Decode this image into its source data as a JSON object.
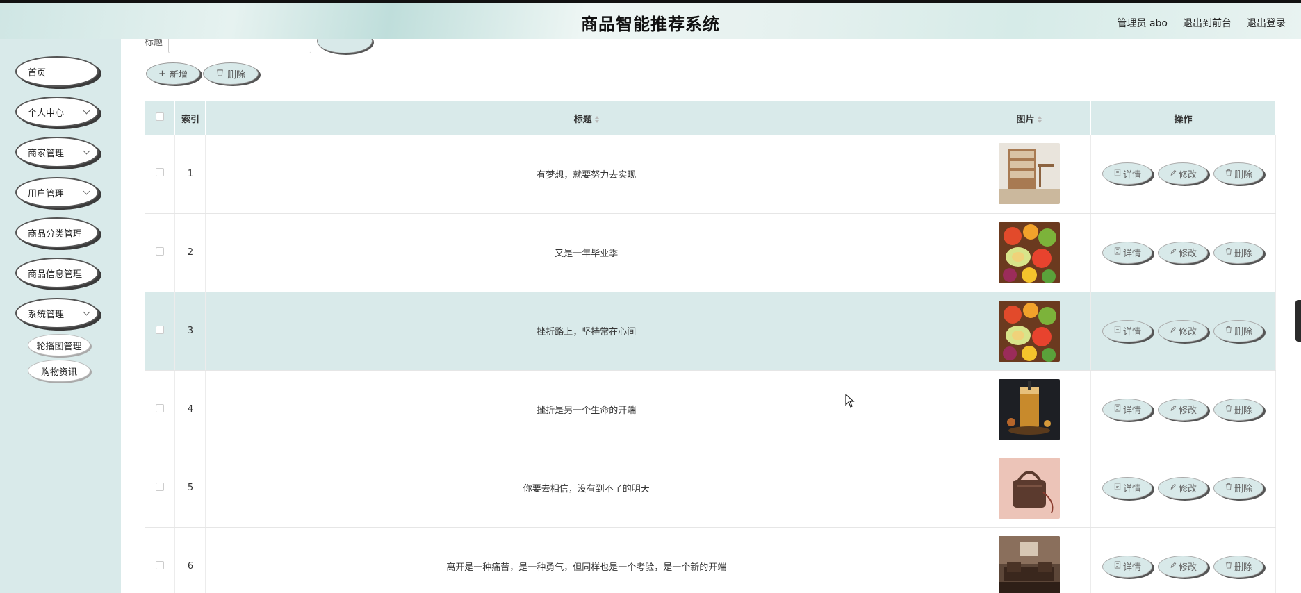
{
  "header": {
    "title": "商品智能推荐系统",
    "admin": "管理员 abo",
    "to_front": "退出到前台",
    "logout": "退出登录"
  },
  "sidebar": {
    "items": [
      {
        "label": "首页"
      },
      {
        "label": "个人中心"
      },
      {
        "label": "商家管理"
      },
      {
        "label": "用户管理"
      },
      {
        "label": "商品分类管理"
      },
      {
        "label": "商品信息管理"
      },
      {
        "label": "系统管理"
      }
    ],
    "sub_items": [
      {
        "label": "轮播图管理"
      },
      {
        "label": "购物资讯"
      }
    ]
  },
  "search": {
    "label": "标题"
  },
  "toolbar": {
    "add_label": "新增",
    "delete_label": "删除"
  },
  "table": {
    "headers": {
      "index": "索引",
      "title": "标题",
      "image": "图片",
      "action": "操作"
    },
    "rows": [
      {
        "index": "1",
        "title": "有梦想，就要努力去实现",
        "image": "furniture-shelf"
      },
      {
        "index": "2",
        "title": "又是一年毕业季",
        "image": "fruit-platter"
      },
      {
        "index": "3",
        "title": "挫折路上，坚持常在心间",
        "image": "fruit-platter"
      },
      {
        "index": "4",
        "title": "挫折是另一个生命的开端",
        "image": "bubble-tea-drinks"
      },
      {
        "index": "5",
        "title": "你要去相信，没有到不了的明天",
        "image": "leather-handbag"
      },
      {
        "index": "6",
        "title": "离开是一种痛苦，是一种勇气，但同样也是一个考验，是一个新的开端",
        "image": "living-room"
      }
    ],
    "actions": {
      "detail": "详情",
      "edit": "修改",
      "delete": "删除"
    }
  },
  "colors": {
    "accent": "#d9eaea",
    "header_bg": "#dcecea"
  }
}
